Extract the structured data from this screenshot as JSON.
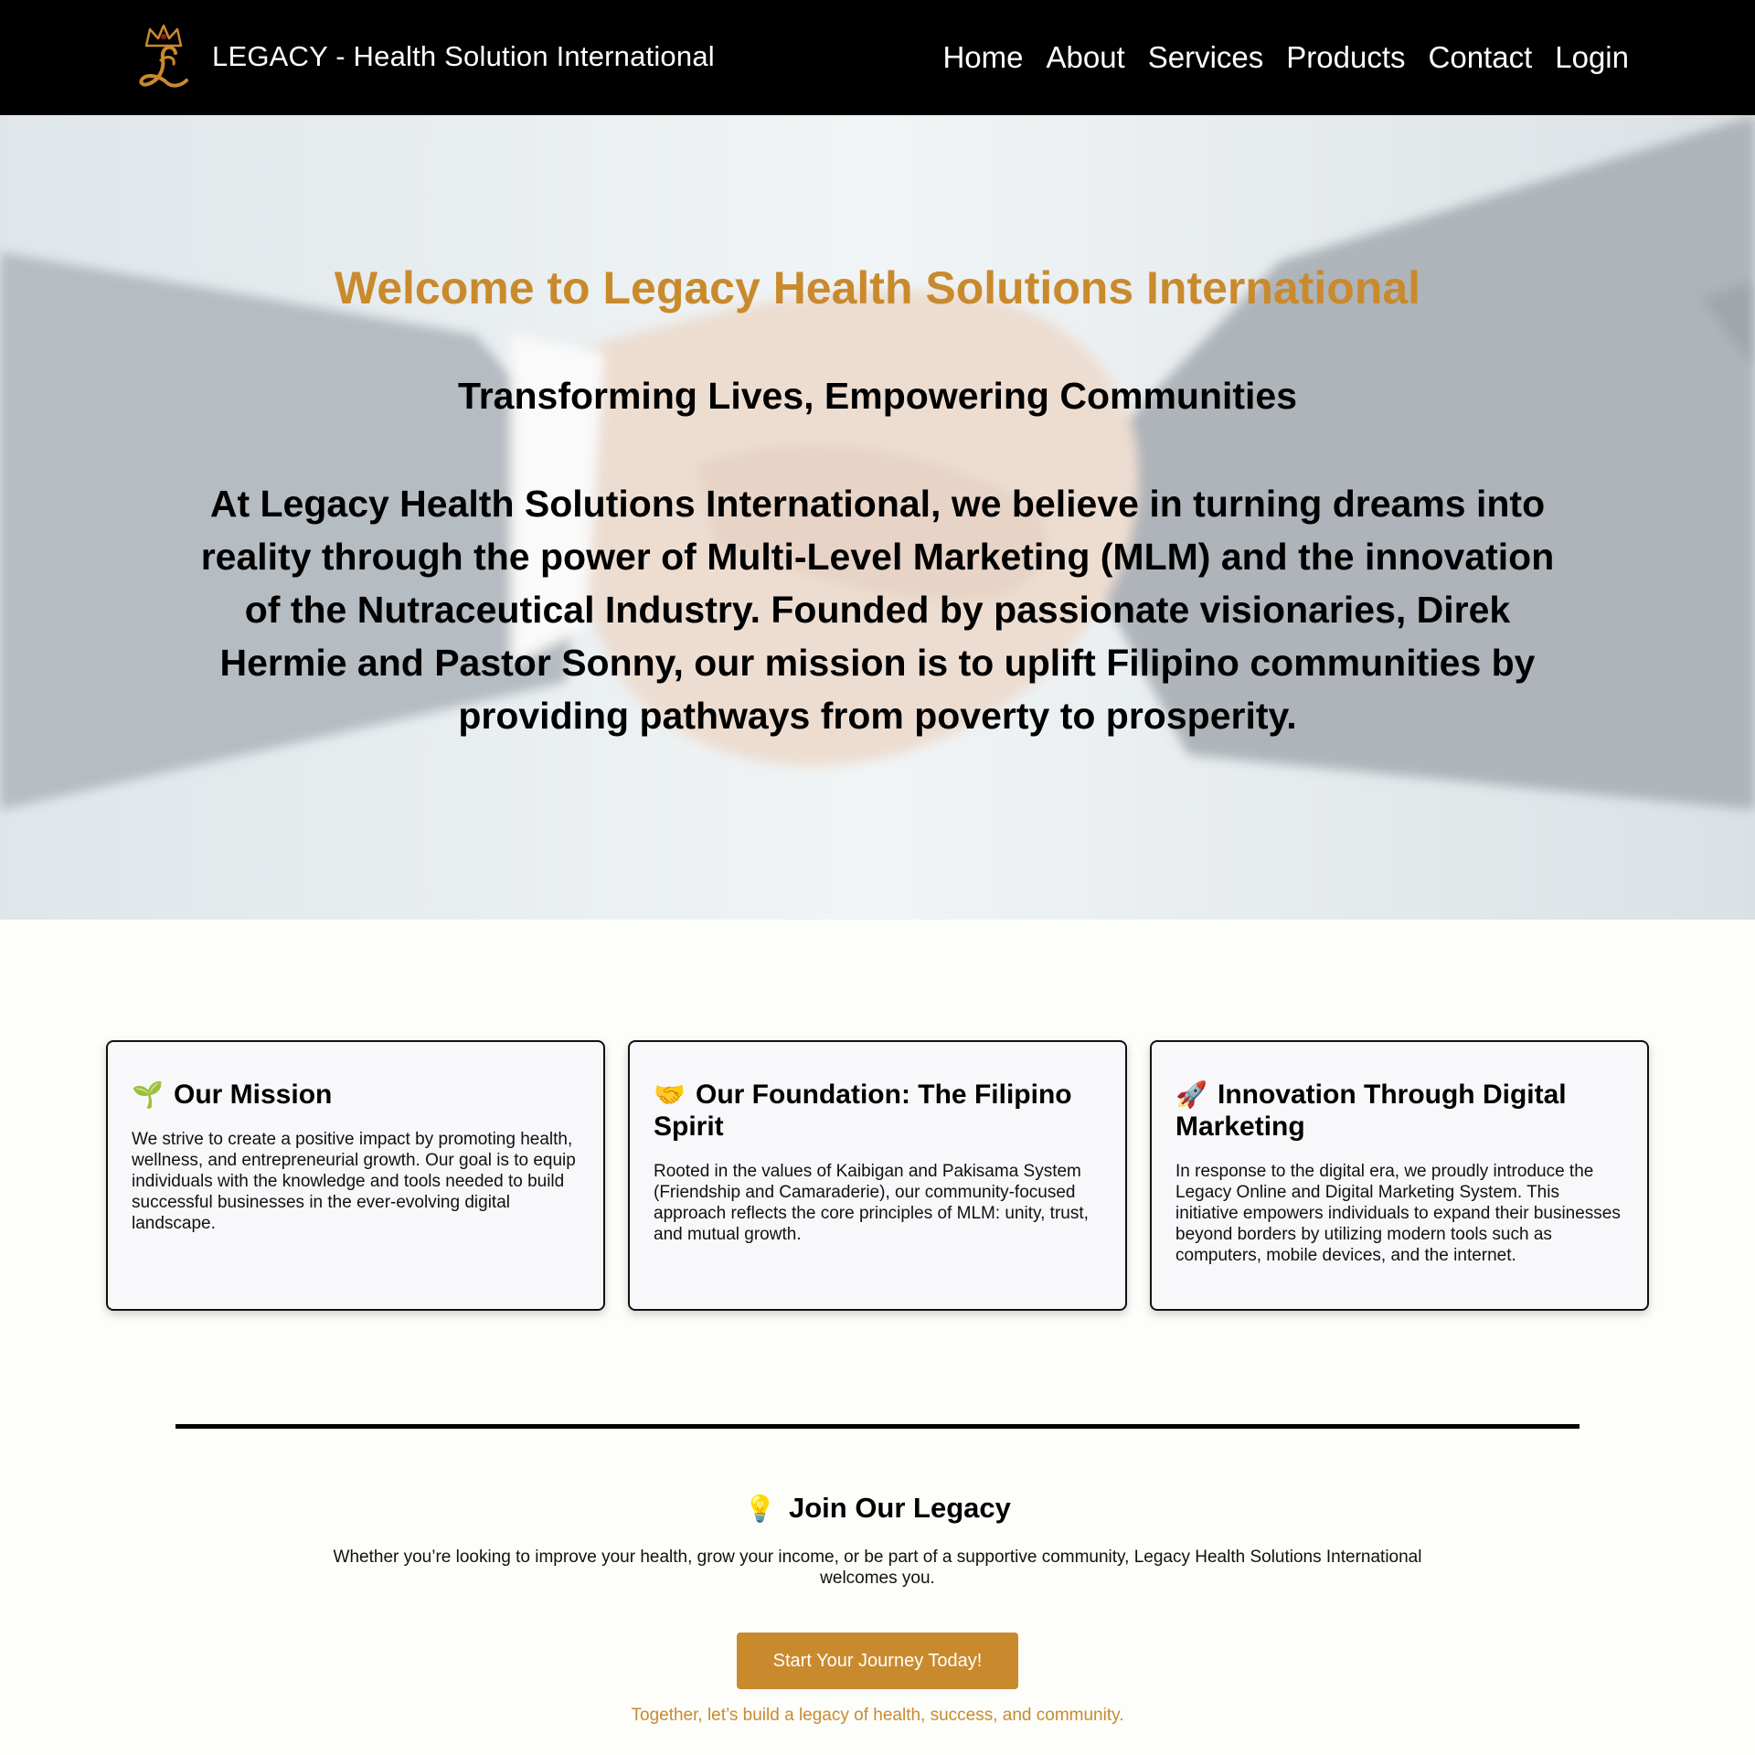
{
  "header": {
    "brand_name": "LEGACY - Health Solution International",
    "nav": [
      "Home",
      "About",
      "Services",
      "Products",
      "Contact",
      "Login"
    ]
  },
  "hero": {
    "title": "Welcome to Legacy Health Solutions International",
    "subtitle": "Transforming Lives, Empowering Communities",
    "text": "At Legacy Health Solutions International, we believe in turning dreams into reality through the power of Multi-Level Marketing (MLM) and the innovation of the Nutraceutical Industry. Founded by passionate visionaries, Direk Hermie and Pastor Sonny, our mission is to uplift Filipino communities by providing pathways from poverty to prosperity."
  },
  "cards": [
    {
      "emoji": "🌱",
      "title": "Our Mission",
      "text": "We strive to create a positive impact by promoting health, wellness, and entrepreneurial growth. Our goal is to equip individuals with the knowledge and tools needed to build successful businesses in the ever-evolving digital landscape."
    },
    {
      "emoji": "🤝",
      "title": "Our Foundation: The Filipino Spirit",
      "text": "Rooted in the values of Kaibigan and Pakisama System (Friendship and Camaraderie), our community-focused approach reflects the core principles of MLM: unity, trust, and mutual growth."
    },
    {
      "emoji": "🚀",
      "title": "Innovation Through Digital Marketing",
      "text": "In response to the digital era, we proudly introduce the Legacy Online and Digital Marketing System. This initiative empowers individuals to expand their businesses beyond borders by utilizing modern tools such as computers, mobile devices, and the internet."
    }
  ],
  "join": {
    "emoji": "💡",
    "title": "Join Our Legacy",
    "text": "Whether you’re looking to improve your health, grow your income, or be part of a supportive community, Legacy Health Solutions International welcomes you.",
    "cta_label": "Start Your Journey Today!",
    "tagline": "Together, let’s build a legacy of health, success, and community."
  },
  "colors": {
    "accent": "#c98a2e",
    "header_bg": "#000000"
  }
}
